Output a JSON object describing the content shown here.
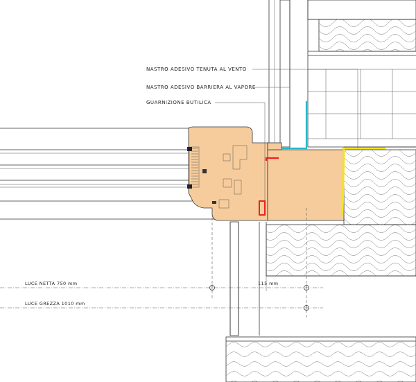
{
  "callouts": {
    "wind_tape": "NASTRO ADESIVO TENUTA AL VENTO",
    "vapor_tape": "NASTRO ADESIVO BARRIERA AL VAPORE",
    "butyl_gasket": "GUARNIZIONE BUTILICA"
  },
  "dimensions": {
    "clear_opening": "LUCE NETTA  750 mm",
    "rough_opening": "LUCE GREZZA  1010 mm",
    "offset": "115 mm"
  },
  "colors": {
    "wood": "#f7cc9c",
    "wind_tape": "#2ab7c9",
    "vapor_tape": "#e8231f",
    "butyl_gasket": "#f2e320"
  }
}
